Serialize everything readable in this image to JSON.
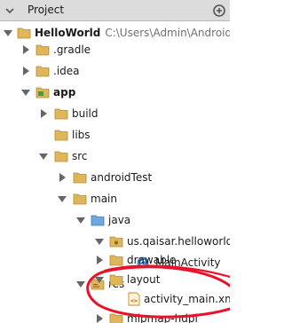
{
  "panel": {
    "title": "Project"
  },
  "tree": [
    {
      "label": "HelloWorld",
      "path": "C:\\Users\\Admin\\AndroidStu"
    },
    {
      "label": ".gradle"
    },
    {
      "label": ".idea"
    },
    {
      "label": "app"
    },
    {
      "label": "build"
    },
    {
      "label": "libs"
    },
    {
      "label": "src"
    },
    {
      "label": "androidTest"
    },
    {
      "label": "main"
    },
    {
      "label": "java"
    },
    {
      "label": "us.qaisar.helloworld"
    },
    {
      "label": "MainActivity"
    },
    {
      "label": "res"
    },
    {
      "label": "drawable"
    },
    {
      "label": "layout"
    },
    {
      "label": "activity_main.xml"
    },
    {
      "label": "mipmap-hdpi"
    }
  ],
  "colors": {
    "folder": "#e0b65a",
    "source_folder": "#6fa8dc",
    "package": "#e0b65a",
    "class": "#3d8fd6",
    "annotation": "#e8132b"
  }
}
